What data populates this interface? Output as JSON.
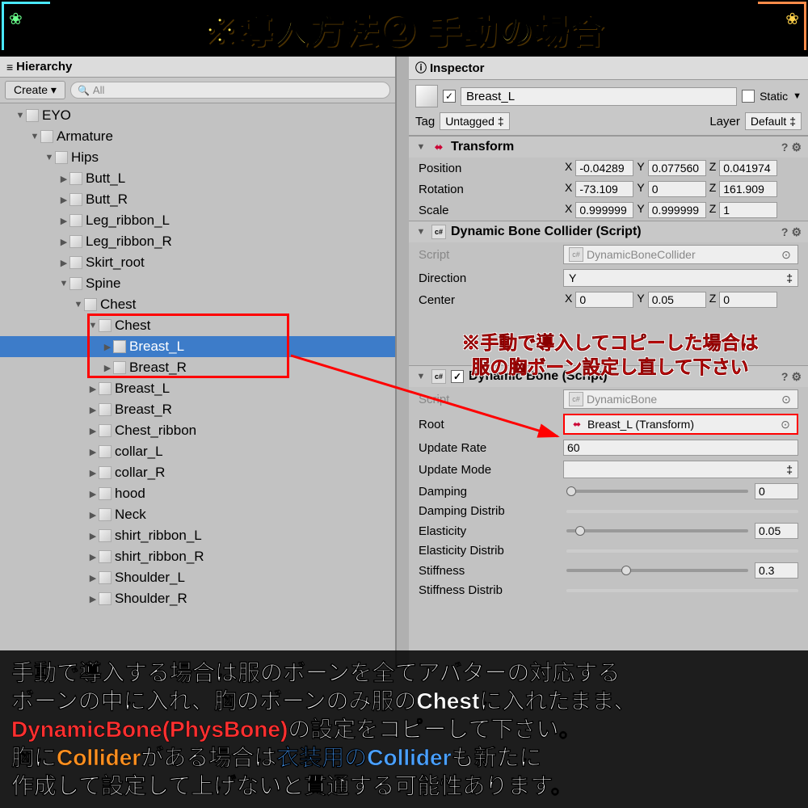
{
  "title": "※導入方法② 手動の場合",
  "hierarchy": {
    "tab": "Hierarchy",
    "create_btn": "Create",
    "search_placeholder": "All",
    "tree": [
      {
        "label": "EYO",
        "indent": 1,
        "fold": "open"
      },
      {
        "label": "Armature",
        "indent": 2,
        "fold": "open"
      },
      {
        "label": "Hips",
        "indent": 3,
        "fold": "open"
      },
      {
        "label": "Butt_L",
        "indent": 4,
        "fold": "closed"
      },
      {
        "label": "Butt_R",
        "indent": 4,
        "fold": "closed"
      },
      {
        "label": "Leg_ribbon_L",
        "indent": 4,
        "fold": "closed"
      },
      {
        "label": "Leg_ribbon_R",
        "indent": 4,
        "fold": "closed"
      },
      {
        "label": "Skirt_root",
        "indent": 4,
        "fold": "closed"
      },
      {
        "label": "Spine",
        "indent": 4,
        "fold": "open"
      },
      {
        "label": "Chest",
        "indent": 5,
        "fold": "open"
      },
      {
        "label": "Chest",
        "indent": 6,
        "fold": "open",
        "box": true
      },
      {
        "label": "Breast_L",
        "indent": 7,
        "fold": "closed",
        "selected": true,
        "box": true
      },
      {
        "label": "Breast_R",
        "indent": 7,
        "fold": "closed",
        "box": true
      },
      {
        "label": "Breast_L",
        "indent": 6,
        "fold": "closed"
      },
      {
        "label": "Breast_R",
        "indent": 6,
        "fold": "closed"
      },
      {
        "label": "Chest_ribbon",
        "indent": 6,
        "fold": "closed"
      },
      {
        "label": "collar_L",
        "indent": 6,
        "fold": "closed"
      },
      {
        "label": "collar_R",
        "indent": 6,
        "fold": "closed"
      },
      {
        "label": "hood",
        "indent": 6,
        "fold": "closed"
      },
      {
        "label": "Neck",
        "indent": 6,
        "fold": "closed"
      },
      {
        "label": "shirt_ribbon_L",
        "indent": 6,
        "fold": "closed"
      },
      {
        "label": "shirt_ribbon_R",
        "indent": 6,
        "fold": "closed"
      },
      {
        "label": "Shoulder_L",
        "indent": 6,
        "fold": "closed"
      },
      {
        "label": "Shoulder_R",
        "indent": 6,
        "fold": "closed"
      }
    ]
  },
  "inspector": {
    "tab": "Inspector",
    "object_name": "Breast_L",
    "static_label": "Static",
    "tag_label": "Tag",
    "tag_value": "Untagged",
    "layer_label": "Layer",
    "layer_value": "Default",
    "transform": {
      "title": "Transform",
      "position": {
        "label": "Position",
        "x": "-0.04289",
        "y": "0.077560",
        "z": "0.041974"
      },
      "rotation": {
        "label": "Rotation",
        "x": "-73.109",
        "y": "0",
        "z": "161.909"
      },
      "scale": {
        "label": "Scale",
        "x": "0.999999",
        "y": "0.999999",
        "z": "1"
      }
    },
    "collider": {
      "title": "Dynamic Bone Collider (Script)",
      "script_label": "Script",
      "script_value": "DynamicBoneCollider",
      "direction_label": "Direction",
      "direction_value": "Y",
      "center_label": "Center",
      "center": {
        "x": "0",
        "y": "0.05",
        "z": "0"
      }
    },
    "dynbone": {
      "title": "Dynamic Bone (Script)",
      "script_label": "Script",
      "script_value": "DynamicBone",
      "root_label": "Root",
      "root_value": "Breast_L (Transform)",
      "update_rate_label": "Update Rate",
      "update_rate_value": "60",
      "update_mode_label": "Update Mode",
      "damping_label": "Damping",
      "damping_value": "0",
      "damping_distrib_label": "Damping Distrib",
      "elasticity_label": "Elasticity",
      "elasticity_value": "0.05",
      "elasticity_distrib_label": "Elasticity Distrib",
      "stiffness_label": "Stiffness",
      "stiffness_value": "0.3",
      "stiffness_distrib_label": "Stiffness Distrib"
    }
  },
  "annotation": {
    "line1": "※手動で導入してコピーした場合は",
    "line2": "服の胸ボーン設定し直して下さい"
  },
  "bottom": {
    "l1a": "手動で導入する場合は服のボーンを全てアバターの対応する",
    "l2a": "ボーンの中に入れ、胸のボーンのみ服のChestに入れたまま、",
    "l3a": "DynamicBone(PhysBone)",
    "l3b": "の設定をコピーして下さい。",
    "l4a": "胸に",
    "l4b": "Collider",
    "l4c": "がある場合は",
    "l4d": "衣装用のCollider",
    "l4e": "も新たに",
    "l5a": "作成して設定して上げないと貫通する可能性あります。"
  }
}
